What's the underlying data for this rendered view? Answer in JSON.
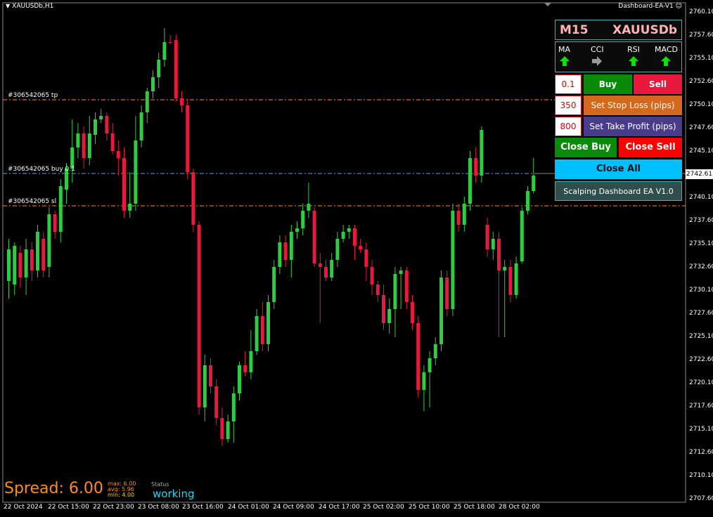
{
  "chart": {
    "symbol_label": "XAUUSDb,H1",
    "ea_label": "Dashboard-EA-V1 ☺",
    "current_price": "2742.61",
    "price_ticks": [
      "2760.10",
      "2757.60",
      "2755.10",
      "2752.60",
      "2750.10",
      "2747.60",
      "2745.10",
      "2740.10",
      "2737.60",
      "2735.10",
      "2732.60",
      "2730.10",
      "2727.60",
      "2725.10",
      "2722.60",
      "2720.10",
      "2717.60",
      "2715.10",
      "2712.60",
      "2710.10",
      "2707.60"
    ],
    "time_ticks": [
      "22 Oct 2024",
      "22 Oct 15:00",
      "22 Oct 23:00",
      "23 Oct 08:00",
      "23 Oct 16:00",
      "24 Oct 01:00",
      "24 Oct 09:00",
      "24 Oct 17:00",
      "25 Oct 02:00",
      "25 Oct 10:00",
      "25 Oct 18:00",
      "28 Oct 02:00"
    ],
    "order_lines": {
      "tp": "#306542065 tp",
      "buy": "#306542065 buy 0.1",
      "sl": "#306542065 sl"
    },
    "colors": {
      "bull": "#2ecc40",
      "bear": "#e8193c",
      "tp_sl_line": "#ff8c1a",
      "buy_line": "#4fa3ff"
    }
  },
  "dashboard": {
    "timeframe": "M15",
    "symbol": "XAUUSDb",
    "indicators": [
      {
        "label": "MA",
        "signal": "up-arrow-icon"
      },
      {
        "label": "CCI",
        "signal": "right-arrow-icon"
      },
      {
        "label": "RSI",
        "signal": "up-arrow-icon"
      },
      {
        "label": "MACD",
        "signal": "up-arrow-icon"
      }
    ],
    "lot": "0.1",
    "buy_label": "Buy",
    "sell_label": "Sell",
    "sl_value": "350",
    "set_sl_label": "Set Stop Loss (pips)",
    "tp_value": "800",
    "set_tp_label": "Set Take Profit (pips)",
    "close_buy_label": "Close Buy",
    "close_sell_label": "Close Sell",
    "close_all_label": "Close All",
    "footer_label": "Scalping Dashboard EA V1.0"
  },
  "spread_info": {
    "spread_text": "Spread: 6.00",
    "max": "max: 6.00",
    "avg": "avg: 5.96",
    "min": "min:  4.00",
    "status_label": "Status",
    "status_value": "working"
  }
}
